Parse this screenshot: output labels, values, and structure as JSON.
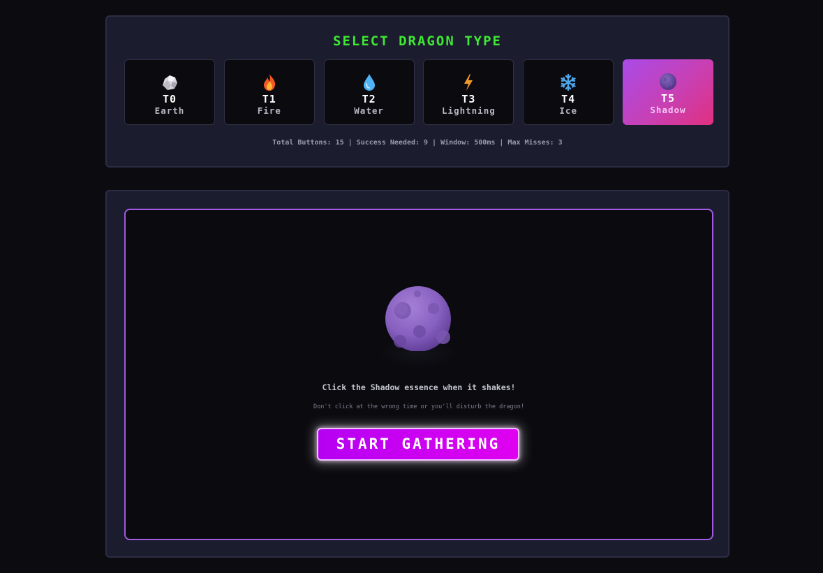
{
  "select_panel": {
    "title": "SELECT DRAGON TYPE",
    "types": [
      {
        "tier": "T0",
        "name": "Earth",
        "icon": "rock-icon",
        "selected": false
      },
      {
        "tier": "T1",
        "name": "Fire",
        "icon": "fire-icon",
        "selected": false
      },
      {
        "tier": "T2",
        "name": "Water",
        "icon": "water-drop-icon",
        "selected": false
      },
      {
        "tier": "T3",
        "name": "Lightning",
        "icon": "lightning-icon",
        "selected": false
      },
      {
        "tier": "T4",
        "name": "Ice",
        "icon": "snowflake-icon",
        "selected": false
      },
      {
        "tier": "T5",
        "name": "Shadow",
        "icon": "shadow-moon-icon",
        "selected": true
      }
    ],
    "stats": "Total Buttons: 15 | Success Needed: 9 | Window: 500ms | Max Misses: 3"
  },
  "game_panel": {
    "essence_icon": "shadow-moon-icon",
    "instruction": "Click the Shadow essence when it shakes!",
    "warning": "Don't click at the wrong time or you'll disturb the dragon!",
    "start_button_label": "START GATHERING"
  },
  "colors": {
    "background": "#0b0b10",
    "panel": "#1b1c2e",
    "title_green": "#3ee833",
    "accent_purple": "#a25ae0",
    "selected_gradient_start": "#a94be8",
    "selected_gradient_end": "#e0307f",
    "button_gradient_start": "#b600f2",
    "button_gradient_end": "#e000f0"
  }
}
